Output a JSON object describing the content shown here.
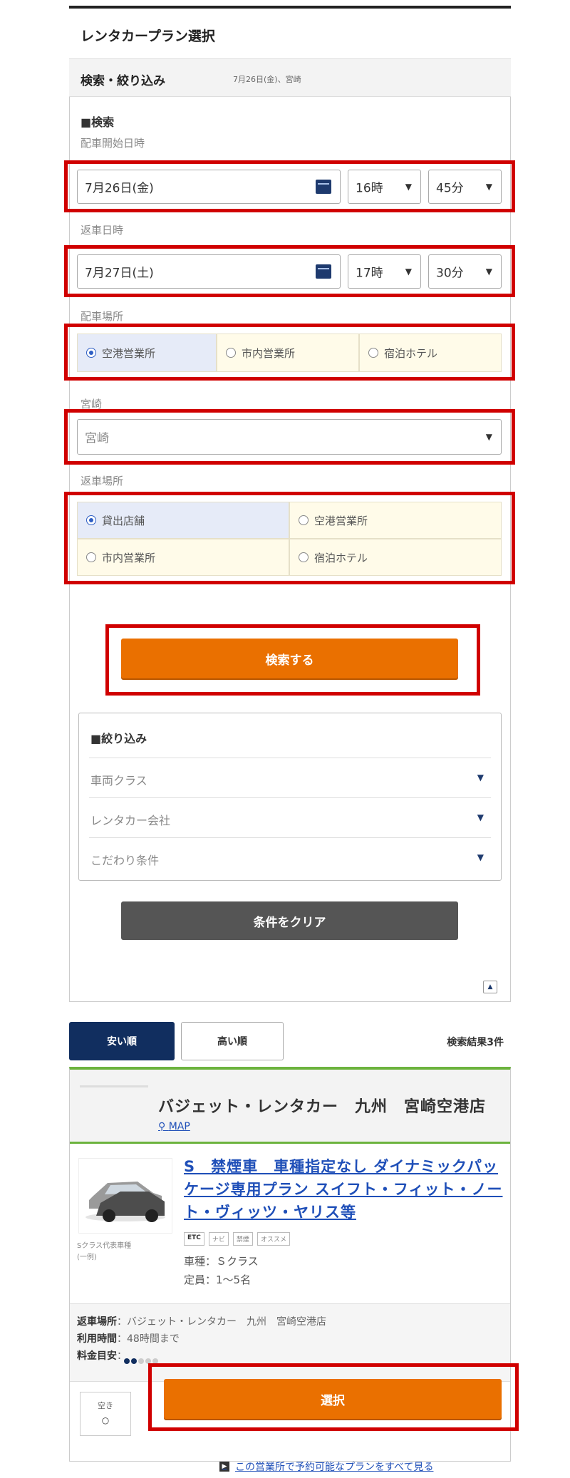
{
  "header": {
    "title": "レンタカープラン選択",
    "search_title": "検索・絞り込み",
    "search_summary": "7月26日(金)、宮崎"
  },
  "search": {
    "section_title": "■検索",
    "pickup_label": "配車開始日時",
    "pickup_date": "7月26日(金)",
    "pickup_hour": "16時",
    "pickup_min": "45分",
    "return_label": "返車日時",
    "return_date": "7月27日(土)",
    "return_hour": "17時",
    "return_min": "30分",
    "pickup_place_label": "配車場所",
    "pickup_places": [
      "空港営業所",
      "市内営業所",
      "宿泊ホテル"
    ],
    "area_label": "宮崎",
    "area_value": "宮崎",
    "return_place_label": "返車場所",
    "return_places": [
      "貸出店舗",
      "空港営業所",
      "市内営業所",
      "宿泊ホテル"
    ],
    "search_button": "検索する"
  },
  "filter": {
    "title": "■絞り込み",
    "rows": [
      "車両クラス",
      "レンタカー会社",
      "こだわり条件"
    ],
    "clear_button": "条件をクリア",
    "page_top": "▲"
  },
  "results": {
    "tab_active": "安い順",
    "tab_inactive": "高い順",
    "count": "検索結果3件"
  },
  "shop": {
    "name": "バジェット・レンタカー　九州　宮崎空港店",
    "map": "MAP",
    "plan_title": "S　禁煙車　車種指定なし ダイナミックパッケージ専用プラン スイフト・フィット・ノート・ヴィッツ・ヤリス等",
    "car_caption": [
      "Sクラス代表車種",
      "(一例)"
    ],
    "tags": [
      "ETC",
      "ナビ",
      "禁煙",
      "オススメ"
    ],
    "class": "車種：Ｓクラス",
    "capacity": "定員：1～5名",
    "return_place": "返車場所：バジェット・レンタカー　九州　宮崎空港店",
    "return_place_key": "返車場所",
    "return_place_val": "：バジェット・レンタカー　九州　宮崎空港店",
    "hours_key": "利用時間",
    "hours_val": "：48時間まで",
    "fee_key": "料金目安",
    "fee_val": "：",
    "fee_level": 2,
    "avail_label": "空き",
    "avail_mark": "○",
    "select_button": "選択",
    "see_all": "この営業所で予約可能なプランをすべて見る"
  },
  "colors": {
    "highlight": "#d00000",
    "orange": "#ea7000",
    "navy": "#112e5f",
    "green": "#6cb33e",
    "link": "#1f4fb8"
  }
}
